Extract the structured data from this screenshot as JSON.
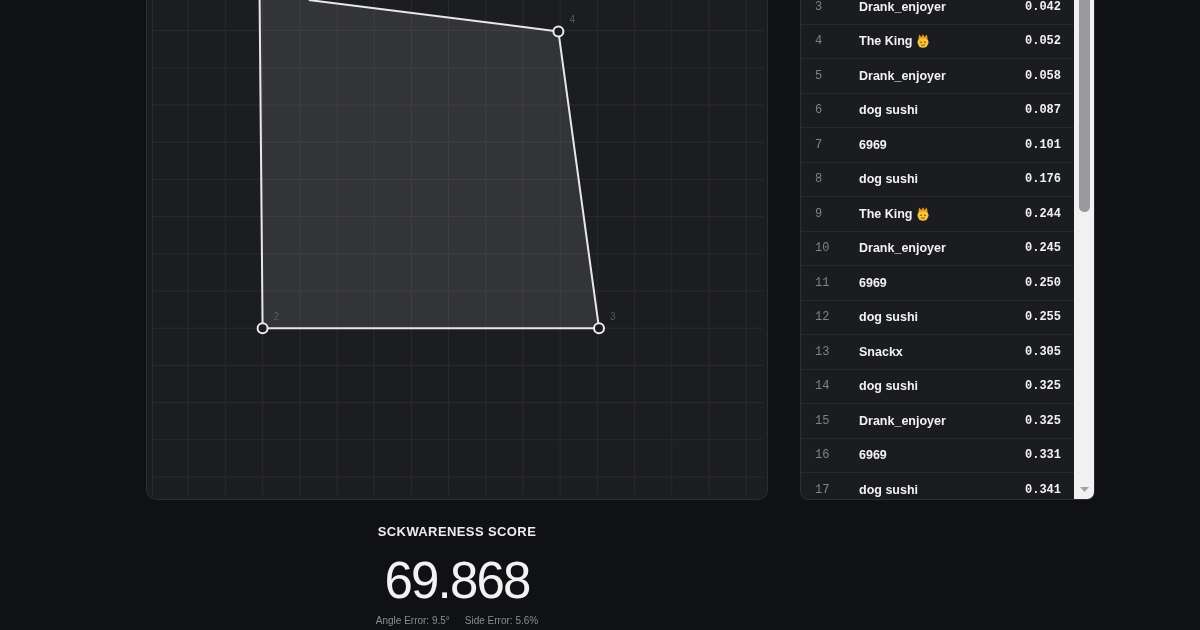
{
  "canvas": {
    "vertex_labels": [
      "2",
      "3",
      "4"
    ]
  },
  "leaderboard": {
    "rows": [
      {
        "rank": "3",
        "name": "Drank_enjoyer",
        "badge": false,
        "score": "0.042"
      },
      {
        "rank": "4",
        "name": "The King",
        "badge": true,
        "score": "0.052"
      },
      {
        "rank": "5",
        "name": "Drank_enjoyer",
        "badge": false,
        "score": "0.058"
      },
      {
        "rank": "6",
        "name": "dog sushi",
        "badge": false,
        "score": "0.087"
      },
      {
        "rank": "7",
        "name": "6969",
        "badge": false,
        "score": "0.101"
      },
      {
        "rank": "8",
        "name": "dog sushi",
        "badge": false,
        "score": "0.176"
      },
      {
        "rank": "9",
        "name": "The King",
        "badge": true,
        "score": "0.244"
      },
      {
        "rank": "10",
        "name": "Drank_enjoyer",
        "badge": false,
        "score": "0.245"
      },
      {
        "rank": "11",
        "name": "6969",
        "badge": false,
        "score": "0.250"
      },
      {
        "rank": "12",
        "name": "dog sushi",
        "badge": false,
        "score": "0.255"
      },
      {
        "rank": "13",
        "name": "Snackx",
        "badge": false,
        "score": "0.305"
      },
      {
        "rank": "14",
        "name": "dog sushi",
        "badge": false,
        "score": "0.325"
      },
      {
        "rank": "15",
        "name": "Drank_enjoyer",
        "badge": false,
        "score": "0.325"
      },
      {
        "rank": "16",
        "name": "6969",
        "badge": false,
        "score": "0.331"
      },
      {
        "rank": "17",
        "name": "dog sushi",
        "badge": false,
        "score": "0.341"
      }
    ]
  },
  "score": {
    "title": "SCKWARENESS SCORE",
    "value": "69.868",
    "angle_error": "Angle Error: 9.5°",
    "side_error": "Side Error: 5.6%"
  }
}
